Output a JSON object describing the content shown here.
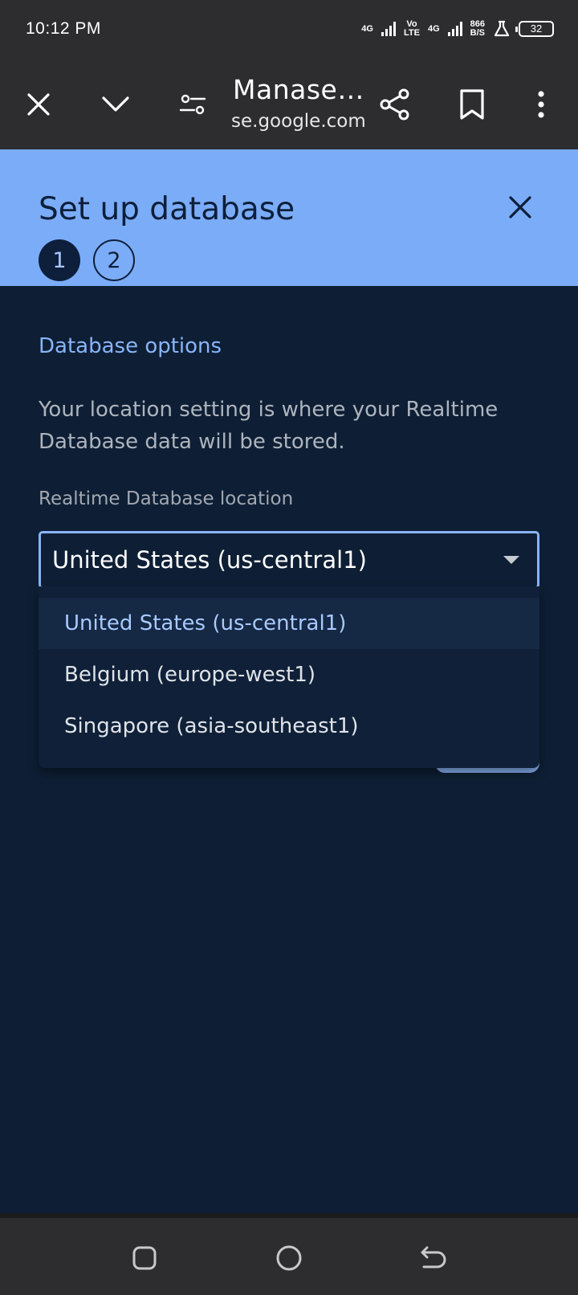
{
  "status_bar": {
    "time": "10:12 PM",
    "network_1": "4G",
    "volte_top": "Vo",
    "volte_bottom": "LTE",
    "network_2": "4G",
    "speed_value": "866",
    "speed_unit": "B/S",
    "battery": "32"
  },
  "browser": {
    "page_title": "Manase…",
    "url": "se.google.com",
    "icons": [
      "close-icon",
      "chevron-down-icon",
      "site-settings-icon",
      "share-icon",
      "bookmark-icon",
      "more-vert-icon"
    ]
  },
  "dialog": {
    "title": "Set up database",
    "steps": [
      "1",
      "2"
    ],
    "active_step": 1,
    "header_color": "#7bacf7"
  },
  "content": {
    "section_title": "Database options",
    "description": "Your location setting is where your Realtime Database data will be stored.",
    "field_label": "Realtime Database location",
    "selected_location": "United States (us-central1)",
    "options": [
      "United States (us-central1)",
      "Belgium (europe-west1)",
      "Singapore (asia-southeast1)"
    ],
    "accent_color": "#8ab4f8"
  },
  "nav_bar": {
    "icons": [
      "recents-icon",
      "home-icon",
      "back-icon"
    ]
  }
}
